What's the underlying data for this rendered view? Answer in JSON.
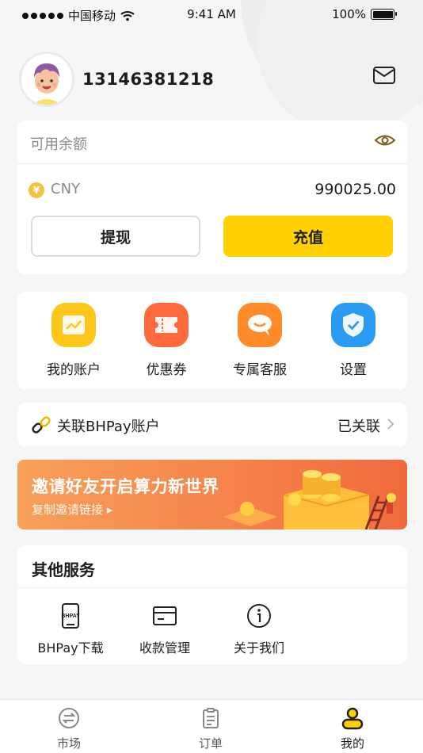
{
  "status_bar": {
    "carrier": "中国移动",
    "time": "9:41 AM",
    "battery": "100%"
  },
  "profile": {
    "phone": "13146381218"
  },
  "balance": {
    "label": "可用余额",
    "currency_symbol": "¥",
    "currency": "CNY",
    "amount": "990025.00",
    "withdraw_label": "提现",
    "recharge_label": "充值"
  },
  "actions": [
    {
      "label": "我的账户",
      "icon": "account-icon",
      "color": "#ffc61a"
    },
    {
      "label": "优惠券",
      "icon": "coupon-icon",
      "color": "#ff6a3d"
    },
    {
      "label": "专属客服",
      "icon": "chat-icon",
      "color": "#ff8a2a"
    },
    {
      "label": "设置",
      "icon": "shield-check-icon",
      "color": "#2a9bf2"
    }
  ],
  "link": {
    "label": "关联BHPay账户",
    "status": "已关联"
  },
  "banner": {
    "title": "邀请好友开启算力新世界",
    "subtitle": "复制邀请链接 ▸"
  },
  "services": {
    "title": "其他服务",
    "items": [
      {
        "label": "BHPay下载",
        "icon": "bhpay-phone-icon",
        "icon_text": "BHPAY"
      },
      {
        "label": "收款管理",
        "icon": "card-icon"
      },
      {
        "label": "关于我们",
        "icon": "info-icon"
      }
    ]
  },
  "tabbar": {
    "items": [
      {
        "label": "市场",
        "icon": "exchange-icon",
        "active": false
      },
      {
        "label": "订单",
        "icon": "clipboard-icon",
        "active": false
      },
      {
        "label": "我的",
        "icon": "user-icon",
        "active": true
      }
    ]
  },
  "colors": {
    "accent": "#ffd100",
    "background": "#f6f6f7"
  }
}
